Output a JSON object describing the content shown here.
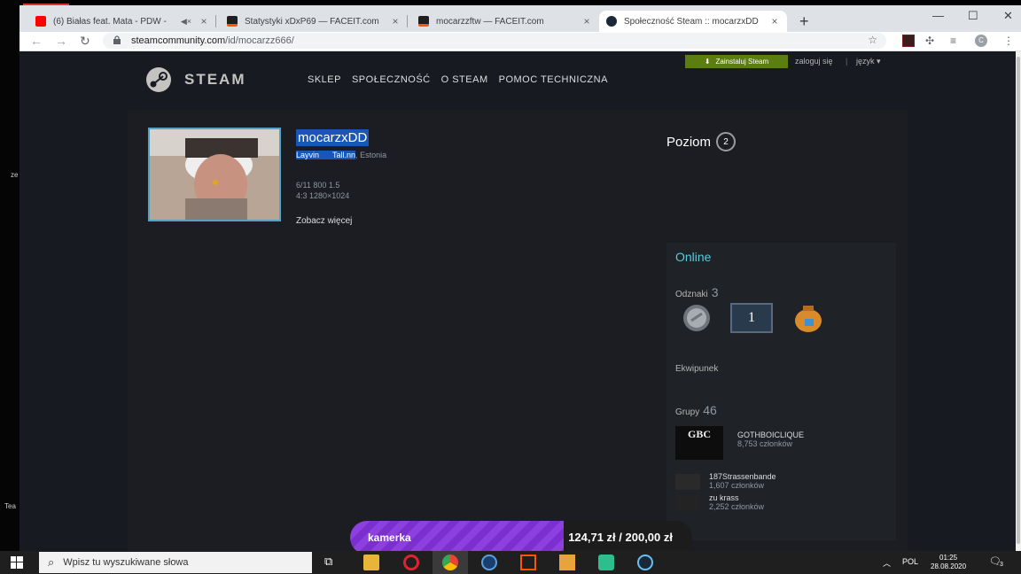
{
  "overlay": {
    "left_text_1": "ze",
    "left_text_2": "Tea"
  },
  "browser": {
    "tabs": [
      {
        "title": "(6) Białas feat. Mata - PDW -",
        "favicon": "youtube-icon",
        "muted": true
      },
      {
        "title": "Statystyki xDxP69 — FACEIT.com",
        "favicon": "faceit-icon"
      },
      {
        "title": "mocarzzftw — FACEIT.com",
        "favicon": "faceit-icon"
      },
      {
        "title": "Społeczność Steam :: mocarzxDD",
        "favicon": "steam-icon",
        "active": true
      }
    ],
    "url_host": "steamcommunity.com",
    "url_path": "/id/mocarzz666/",
    "profile_initial": "C"
  },
  "steam": {
    "logo_text": "STEAM",
    "nav": [
      "SKLEP",
      "SPOŁECZNOŚĆ",
      "O STEAM",
      "POMOC TECHNICZNA"
    ],
    "install_label": "Zainstaluj Steam",
    "login_label": "zaloguj się",
    "separator": "|",
    "language_label": "język"
  },
  "profile": {
    "persona_name": "mocarzxDD",
    "real_name": "Layvin",
    "location_part": "Tall.nn",
    "country": "Estonia",
    "summary_line1": "6/11 800 1.5",
    "summary_line2": "4:3 1280×1024",
    "view_more": "Zobacz więcej",
    "level_label": "Poziom",
    "level_value": "2",
    "status": "Online",
    "badges_label": "Odznaki",
    "badges_count": "3",
    "badge_years": "1",
    "inventory_label": "Ekwipunek",
    "groups_label": "Grupy",
    "groups_count": "46",
    "groups": [
      {
        "name": "GOTHBOICLIQUE",
        "members": "8,753 członków",
        "logo": "GBC"
      },
      {
        "name": "187Strassenbande",
        "members": "1,607 członków"
      },
      {
        "name": "zu krass",
        "members": "2,252 członków"
      }
    ]
  },
  "donation": {
    "label": "kamerka",
    "amount": "124,71 zł / 200,00 zł",
    "progress": 0.6236
  },
  "taskbar": {
    "search_placeholder": "Wpisz tu wyszukiwane słowa",
    "language": "POL",
    "time": "01:25",
    "date": "28.08.2020",
    "notifications": "3"
  },
  "colors": {
    "steam_bg": "#171a21",
    "online": "#57cbde",
    "install_green": "#5c7e10",
    "selection": "#1a56b8",
    "donation_purple": "#7b2fd0"
  }
}
